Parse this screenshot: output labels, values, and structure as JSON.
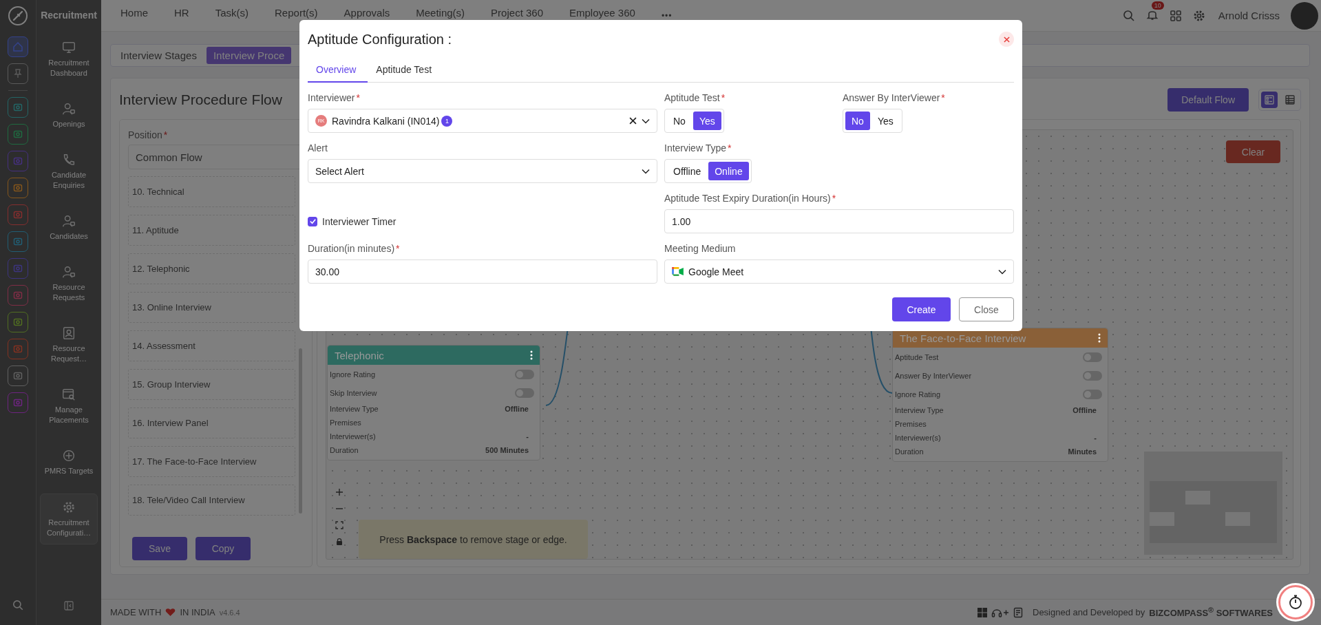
{
  "topbar": {
    "app_name": "Recruitment",
    "nav": [
      "Home",
      "HR",
      "Task(s)",
      "Report(s)",
      "Approvals",
      "Meeting(s)",
      "Project 360",
      "Employee 360"
    ],
    "more": "•••",
    "notification_count": "10",
    "user_name": "Arnold Crisss"
  },
  "rail": {
    "items": [
      {
        "color": "#34428a",
        "selected": true
      },
      {
        "color": "#5a5a5a",
        "selected": false
      },
      {
        "color": "#236666",
        "selected": false
      },
      {
        "color": "#1f6a40",
        "selected": false
      },
      {
        "color": "#463080",
        "selected": false
      },
      {
        "color": "#85561c",
        "selected": false
      },
      {
        "color": "#852e2e",
        "selected": false
      },
      {
        "color": "#215e74",
        "selected": false
      },
      {
        "color": "#3d3580",
        "selected": false
      },
      {
        "color": "#802d46",
        "selected": false
      },
      {
        "color": "#516e21",
        "selected": false
      },
      {
        "color": "#853221",
        "selected": false
      },
      {
        "color": "#606060",
        "selected": false
      },
      {
        "color": "#6e2480",
        "selected": false
      }
    ]
  },
  "sidebar": {
    "items": [
      {
        "label": "Recruitment Dashboard",
        "selected": false
      },
      {
        "label": "Openings",
        "selected": false
      },
      {
        "label": "Candidate Enquiries",
        "selected": false
      },
      {
        "label": "Candidates",
        "selected": false
      },
      {
        "label": "Resource Requests",
        "selected": false
      },
      {
        "label": "Resource Request…",
        "selected": false
      },
      {
        "label": "Manage Placements",
        "selected": false
      },
      {
        "label": "PMRS Targets",
        "selected": false
      },
      {
        "label": "Recruitment Configurati…",
        "selected": true
      }
    ]
  },
  "page_tabs": [
    {
      "label": "Interview Stages",
      "selected": false
    },
    {
      "label": "Interview Proce",
      "selected": true
    }
  ],
  "flow": {
    "title": "Interview Procedure Flow",
    "default_flow_button": "Default Flow",
    "view_toggle": [
      {
        "selected": true
      },
      {
        "selected": false
      }
    ],
    "position": {
      "label": "Position",
      "required_mark": "*",
      "value": "Common Flow"
    },
    "stages": [
      "10. Technical",
      "11. Aptitude",
      "12. Telephonic",
      "13. Online Interview",
      "14. Assessment",
      "15. Group Interview",
      "16. Interview Panel",
      "17. The Face-to-Face Interview",
      "18. Tele/Video Call Interview"
    ],
    "actions": [
      "Save",
      "Copy"
    ]
  },
  "canvas": {
    "clear_button": "Clear",
    "hint": "Press **Backspace** to remove stage or edge.",
    "nodes": [
      {
        "title": "Telephonic",
        "color": "#2d6a60",
        "rows": [
          {
            "kind": "toggle",
            "label": "Ignore Rating",
            "on": false
          },
          {
            "kind": "toggle",
            "label": "Skip Interview",
            "on": false
          },
          {
            "kind": "info",
            "label": "Interview Type",
            "value": "Offline"
          },
          {
            "kind": "info",
            "label": "Premises"
          },
          {
            "kind": "info",
            "label": "Interviewer(s)",
            "value": "-"
          },
          {
            "kind": "info",
            "label": "Duration",
            "value": "500 Minutes"
          }
        ]
      },
      {
        "title": "The Face-to-Face Interview",
        "color": "#8a6038",
        "rows": [
          {
            "kind": "toggle",
            "label": "Aptitude Test",
            "on": false
          },
          {
            "kind": "toggle",
            "label": "Answer By InterViewer",
            "on": false
          },
          {
            "kind": "toggle",
            "label": "Ignore Rating",
            "on": false
          },
          {
            "kind": "info",
            "label": "Interview Type",
            "value": "Offline"
          },
          {
            "kind": "info",
            "label": "Premises"
          },
          {
            "kind": "info",
            "label": "Interviewer(s)",
            "value": "-"
          },
          {
            "kind": "info",
            "label": "Duration",
            "value": "Minutes"
          }
        ]
      }
    ]
  },
  "footer": {
    "made_with": "MADE WITH",
    "in_india": "IN INDIA",
    "version": "v4.6.4",
    "credit": "Designed and Developed by",
    "company": "BIZCOMPASS$^{®}$ SOFTWARES"
  },
  "modal": {
    "title": "Aptitude Configuration :",
    "tabs": [
      {
        "label": "Overview",
        "selected": true
      },
      {
        "label": "Aptitude Test",
        "selected": false
      }
    ],
    "interviewer": {
      "label": "Interviewer",
      "required_mark": "*",
      "avatar": "RK",
      "value": "Ravindra Kalkani (IN014)",
      "count": "1"
    },
    "aptitude_test": {
      "label": "Aptitude Test",
      "required_mark": "*",
      "options": [
        {
          "label": "No",
          "selected": false
        },
        {
          "label": "Yes",
          "selected": true
        }
      ]
    },
    "answer_by_interviewer": {
      "label": "Answer By InterViewer",
      "required_mark": "*",
      "options": [
        {
          "label": "No",
          "selected": true
        },
        {
          "label": "Yes",
          "selected": false
        }
      ]
    },
    "alert": {
      "label": "Alert",
      "placeholder": "Select Alert"
    },
    "interview_type": {
      "label": "Interview Type",
      "required_mark": "*",
      "options": [
        {
          "label": "Offline",
          "selected": false
        },
        {
          "label": "Online",
          "selected": true
        }
      ]
    },
    "interviewer_timer": {
      "label": "Interviewer Timer",
      "checked": true
    },
    "expiry": {
      "label": "Aptitude Test Expiry Duration(in Hours)",
      "required_mark": "*",
      "value": "1.00"
    },
    "duration": {
      "label": "Duration(in minutes)",
      "required_mark": "*",
      "value": "30.00"
    },
    "meeting_medium": {
      "label": "Meeting Medium",
      "value": "Google Meet"
    },
    "buttons": [
      "Create",
      "Close"
    ]
  }
}
